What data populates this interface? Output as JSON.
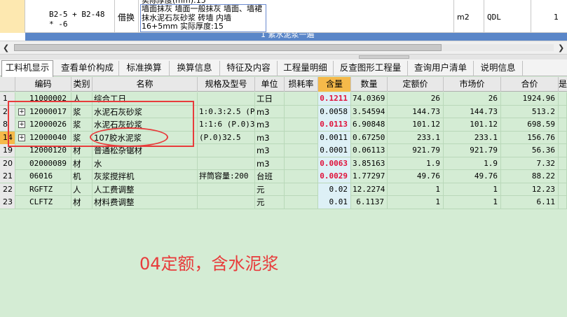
{
  "top_row": {
    "partial_text": "实际厚度(mm):15",
    "code": "B2-5 + B2-48\n* -6",
    "type": "借换",
    "desc": "墙面抹灰 墙面一般抹灰 墙面、墙裙抹水泥石灰砂浆 砖墙 内墙 16+5mm   实际厚度:15",
    "unit": "m2",
    "qty_expr": "QDL",
    "qty": "1",
    "strip_text": "1 素水泥浆一遍"
  },
  "tabs": [
    {
      "label": "工料机显示",
      "active": true
    },
    {
      "label": "查看单价构成"
    },
    {
      "label": "标准换算"
    },
    {
      "label": "换算信息"
    },
    {
      "label": "特征及内容"
    },
    {
      "label": "工程量明细"
    },
    {
      "label": "反查图形工程量"
    },
    {
      "label": "查询用户清单"
    },
    {
      "label": "说明信息"
    }
  ],
  "columns": [
    "编码",
    "类别",
    "名称",
    "规格及型号",
    "单位",
    "损耗率",
    "含量",
    "数量",
    "定额价",
    "市场价",
    "合价",
    "是"
  ],
  "rows": [
    {
      "num": "1",
      "code": "11000002",
      "cat": "人",
      "name": "综合工日",
      "spec": "",
      "unit": "工日",
      "loss": "",
      "qty": "0.1211",
      "qty_red": true,
      "amount": "74.0369",
      "price": "26",
      "market": "26",
      "total": "1924.96",
      "expand": false
    },
    {
      "num": "2",
      "code": "12000017",
      "cat": "浆",
      "name": "水泥石灰砂浆",
      "spec": "1:0.3:2.5 (P",
      "unit": "m3",
      "loss": "",
      "qty": "0.0058",
      "qty_red": false,
      "amount": "3.54594",
      "price": "144.73",
      "market": "144.73",
      "total": "513.2",
      "expand": true
    },
    {
      "num": "8",
      "code": "12000026",
      "cat": "浆",
      "name": "水泥石灰砂浆",
      "spec": "1:1:6 (P.0)3",
      "unit": "m3",
      "loss": "",
      "qty": "0.0113",
      "qty_red": true,
      "amount": "6.90848",
      "price": "101.12",
      "market": "101.12",
      "total": "698.59",
      "expand": true
    },
    {
      "num": "14",
      "code": "12000040",
      "cat": "浆",
      "name": "107胶水泥浆",
      "spec": "(P.0)32.5",
      "unit": "m3",
      "loss": "",
      "qty": "0.0011",
      "qty_red": false,
      "amount": "0.67250",
      "price": "233.1",
      "market": "233.1",
      "total": "156.76",
      "expand": true,
      "selected": true
    },
    {
      "num": "19",
      "code": "12000120",
      "cat": "材",
      "name": "普通松杂锯材",
      "spec": "",
      "unit": "m3",
      "loss": "",
      "qty": "0.0001",
      "qty_red": false,
      "amount": "0.06113",
      "price": "921.79",
      "market": "921.79",
      "total": "56.36",
      "expand": false
    },
    {
      "num": "20",
      "code": "02000089",
      "cat": "材",
      "name": "水",
      "spec": "",
      "unit": "m3",
      "loss": "",
      "qty": "0.0063",
      "qty_red": true,
      "amount": "3.85163",
      "price": "1.9",
      "market": "1.9",
      "total": "7.32",
      "expand": false
    },
    {
      "num": "21",
      "code": "06016",
      "cat": "机",
      "name": "灰浆搅拌机",
      "spec": "拌筒容量:200",
      "unit": "台班",
      "loss": "",
      "qty": "0.0029",
      "qty_red": true,
      "amount": "1.77297",
      "price": "49.76",
      "market": "49.76",
      "total": "88.22",
      "expand": false
    },
    {
      "num": "22",
      "code": "RGFTZ",
      "cat": "人",
      "name": "人工费调整",
      "spec": "",
      "unit": "元",
      "loss": "",
      "qty": "0.02",
      "qty_red": false,
      "amount": "12.2274",
      "price": "1",
      "market": "1",
      "total": "12.23",
      "expand": false
    },
    {
      "num": "23",
      "code": "CLFTZ",
      "cat": "材",
      "name": "材料费调整",
      "spec": "",
      "unit": "元",
      "loss": "",
      "qty": "0.01",
      "qty_red": false,
      "amount": "6.1137",
      "price": "1",
      "market": "1",
      "total": "6.11",
      "expand": false
    }
  ],
  "annotation": {
    "text": "04定额，含水泥浆",
    "color": "#e83b3b"
  },
  "colors": {
    "grid_bg": "#d4ecd4",
    "header_bg": "#e8e8e8",
    "highlight": "#f5b94a",
    "qty_bg": "#ddf0f6",
    "red_value": "#e0103a",
    "strip": "#5a86c8"
  }
}
